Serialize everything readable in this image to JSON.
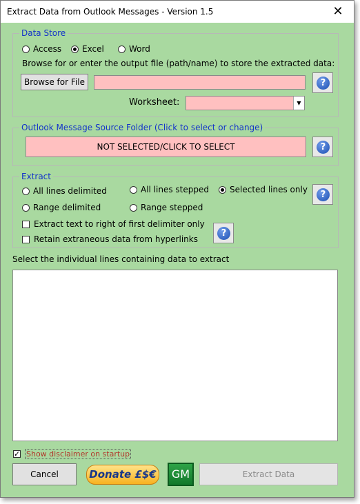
{
  "window": {
    "title": "Extract Data from Outlook Messages - Version 1.5",
    "close_glyph": "✕"
  },
  "data_store": {
    "legend": "Data Store",
    "options": [
      {
        "label": "Access",
        "checked": false
      },
      {
        "label": "Excel",
        "checked": true
      },
      {
        "label": "Word",
        "checked": false
      }
    ],
    "browse_instruction": "Browse for or enter the output file (path/name) to store the extracted data:",
    "browse_button": "Browse for File",
    "file_path_value": "",
    "worksheet_label": "Worksheet:",
    "worksheet_value": "",
    "help": "?"
  },
  "source_folder": {
    "legend": "Outlook Message Source Folder (Click to select or change)",
    "button": "NOT SELECTED/CLICK TO SELECT",
    "help": "?"
  },
  "extract": {
    "legend": "Extract",
    "options": [
      {
        "label": "All lines delimited",
        "checked": false
      },
      {
        "label": "All lines stepped",
        "checked": false
      },
      {
        "label": "Selected lines only",
        "checked": true
      },
      {
        "label": "Range delimited",
        "checked": false
      },
      {
        "label": "Range stepped",
        "checked": false
      }
    ],
    "checkboxes": [
      {
        "label": "Extract text to right of first delimiter only",
        "checked": false
      },
      {
        "label": "Retain extraneous data from hyperlinks",
        "checked": false
      }
    ],
    "help": "?"
  },
  "lines_section": {
    "label": "Select the individual lines containing data to extract"
  },
  "footer": {
    "disclaimer_label": "Show disclaimer on startup",
    "disclaimer_checked": true,
    "cancel": "Cancel",
    "donate": "Donate £$€",
    "gm": "GM",
    "extract_data": "Extract Data"
  },
  "colors": {
    "background": "#a9d9a0",
    "legend_text": "#1433c9",
    "required_field": "#ffc0c0"
  }
}
